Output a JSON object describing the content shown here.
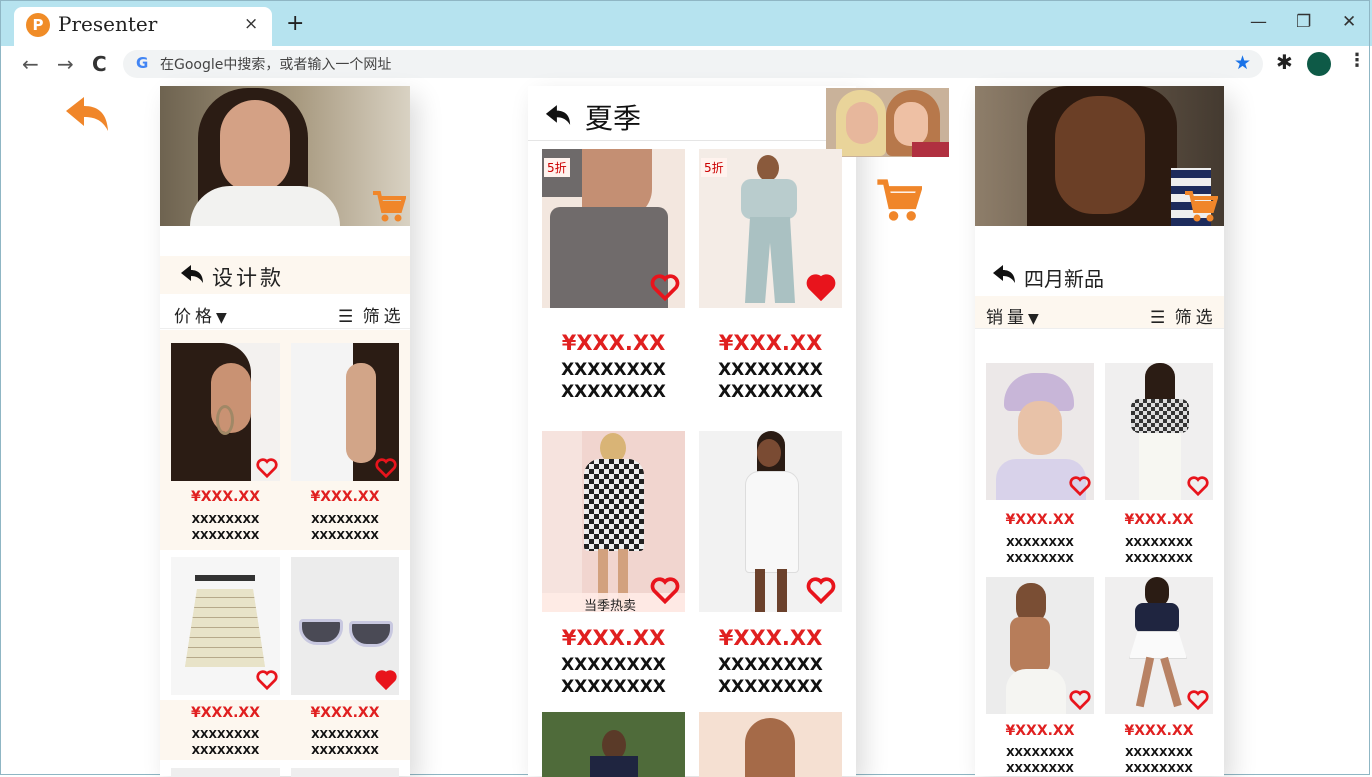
{
  "browser": {
    "tab_title": "Presenter",
    "tab_icon_letter": "P",
    "tab_close": "×",
    "new_tab": "+",
    "minimize": "—",
    "restore": "❐",
    "close": "✕",
    "back": "←",
    "forward": "→",
    "reload": "C",
    "google_g": "G",
    "omnibox_text": "在Google中搜索，或者输入一个网址",
    "star": "★",
    "extensions": "✱",
    "menu": "⋮"
  },
  "left": {
    "header_title": "设计款",
    "sort_label": "价格",
    "filter_label": "筛选",
    "products": [
      {
        "price": "¥XXX.XX",
        "line1": "XXXXXXXX",
        "line2": "XXXXXXXX"
      },
      {
        "price": "¥XXX.XX",
        "line1": "XXXXXXXX",
        "line2": "XXXXXXXX"
      },
      {
        "price": "¥XXX.XX",
        "line1": "XXXXXXXX",
        "line2": "XXXXXXXX"
      },
      {
        "price": "¥XXX.XX",
        "line1": "XXXXXXXX",
        "line2": "XXXXXXXX"
      }
    ]
  },
  "middle": {
    "header_title": "夏季",
    "products": [
      {
        "badge": "5折",
        "price": "¥XXX.XX",
        "line1": "XXXXXXXX",
        "line2": "XXXXXXXX"
      },
      {
        "badge": "5折",
        "price": "¥XXX.XX",
        "line1": "XXXXXXXX",
        "line2": "XXXXXXXX"
      },
      {
        "caption": "当季热卖",
        "price": "¥XXX.XX",
        "line1": "XXXXXXXX",
        "line2": "XXXXXXXX"
      },
      {
        "price": "¥XXX.XX",
        "line1": "XXXXXXXX",
        "line2": "XXXXXXXX"
      }
    ]
  },
  "right": {
    "header_title": "四月新品",
    "sort_label": "销量",
    "filter_label": "筛选",
    "products": [
      {
        "price": "¥XXX.XX",
        "line1": "XXXXXXXX",
        "line2": "XXXXXXXX"
      },
      {
        "price": "¥XXX.XX",
        "line1": "XXXXXXXX",
        "line2": "XXXXXXXX"
      },
      {
        "price": "¥XXX.XX",
        "line1": "XXXXXXXX",
        "line2": "XXXXXXXX"
      },
      {
        "price": "¥XXX.XX",
        "line1": "XXXXXXXX",
        "line2": "XXXXXXXX"
      }
    ]
  },
  "colors": {
    "accent": "#f0862a",
    "price": "#e02020",
    "heart": "#e8141c",
    "tabbar": "#b6e3ef"
  }
}
